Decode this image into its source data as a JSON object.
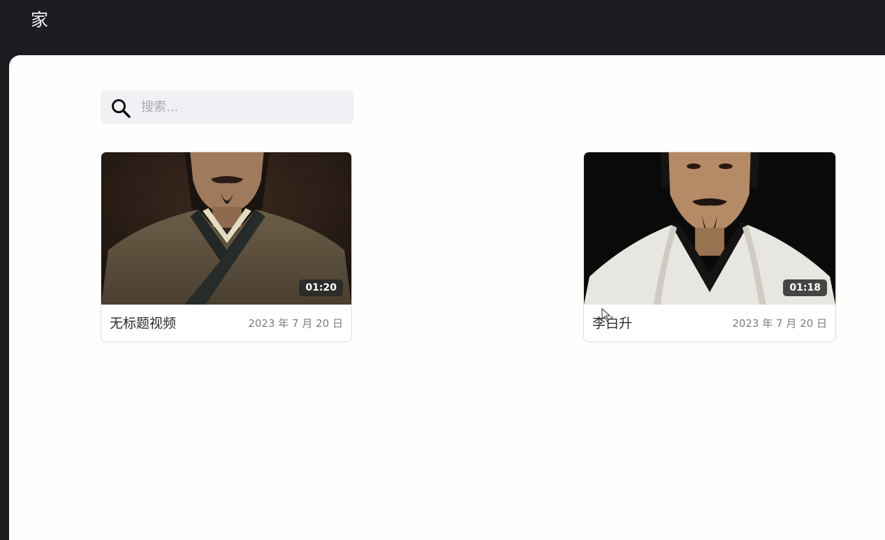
{
  "header": {
    "title": "家"
  },
  "search": {
    "placeholder": "搜索...",
    "value": ""
  },
  "videos": [
    {
      "title": "无标题视频",
      "date": "2023 年 7 月 20 日",
      "duration": "01:20"
    },
    {
      "title": "李白升",
      "date": "2023 年 7 月 20 日",
      "duration": "01:18"
    }
  ],
  "colors": {
    "topbar": "#1c1d21",
    "content_bg": "#fefefc",
    "search_bg": "#f0f1f4",
    "duration_badge": "#282828"
  },
  "icons": {
    "search": "search-icon",
    "cursor": "mouse-pointer-icon"
  }
}
